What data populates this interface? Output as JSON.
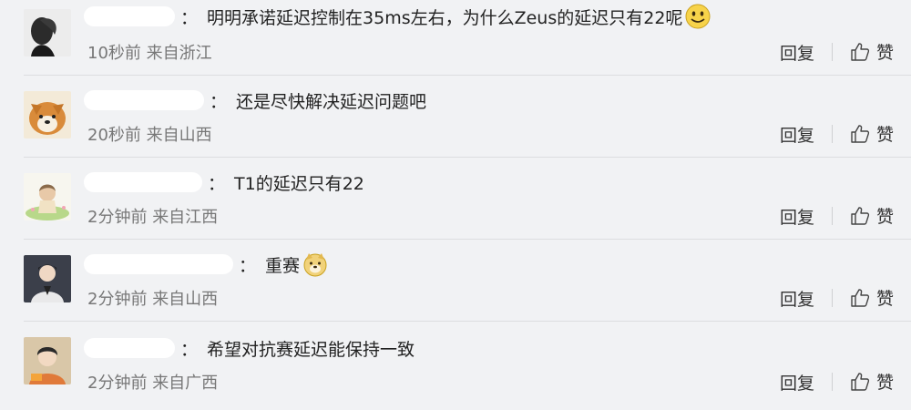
{
  "comments": [
    {
      "text": "明明承诺延迟控制在35ms左右，为什么Zeus的延迟只有22呢",
      "emoji": "smile-emoji",
      "time": "10秒前",
      "location": "来自浙江",
      "reply_label": "回复",
      "like_label": "赞"
    },
    {
      "text": "还是尽快解决延迟问题吧",
      "time": "20秒前",
      "location": "来自山西",
      "reply_label": "回复",
      "like_label": "赞"
    },
    {
      "text": "T1的延迟只有22",
      "time": "2分钟前",
      "location": "来自江西",
      "reply_label": "回复",
      "like_label": "赞"
    },
    {
      "text": "重赛",
      "emoji": "doge-emoji",
      "time": "2分钟前",
      "location": "来自山西",
      "reply_label": "回复",
      "like_label": "赞"
    },
    {
      "text": "希望对抗赛延迟能保持一致",
      "time": "2分钟前",
      "location": "来自广西",
      "reply_label": "回复",
      "like_label": "赞"
    }
  ],
  "colors": {
    "background": "#f1f2f4",
    "text": "#222222",
    "meta": "#777777",
    "emoji_yellow": "#f7d34a"
  }
}
